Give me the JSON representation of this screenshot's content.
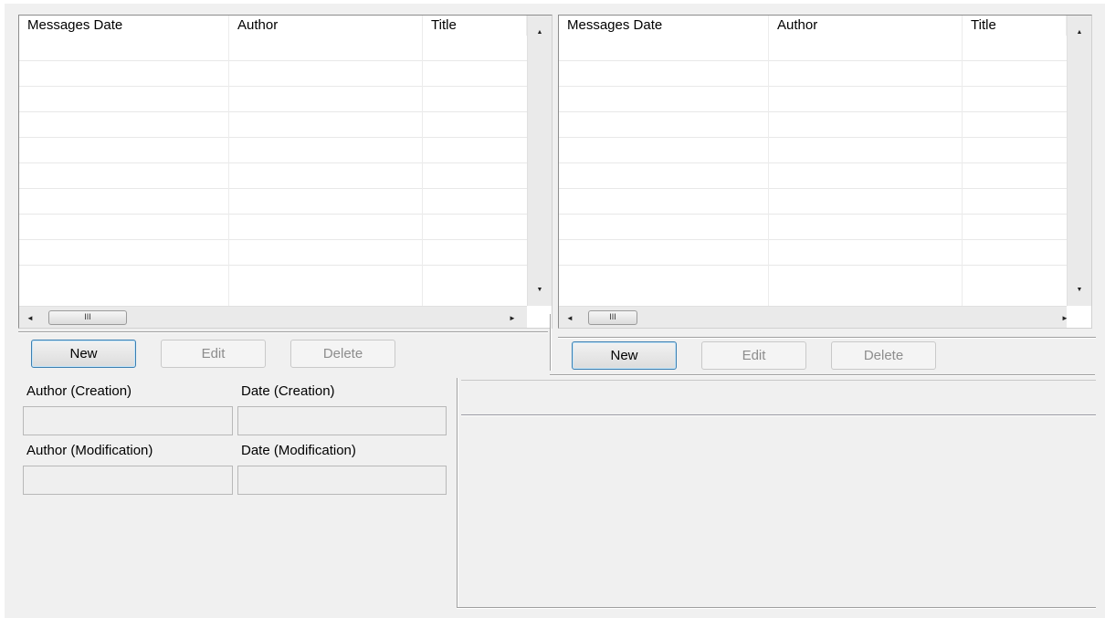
{
  "left_grid": {
    "columns": [
      "Messages Date",
      "Author",
      "Title"
    ],
    "row_count": 10
  },
  "right_grid": {
    "columns": [
      "Messages Date",
      "Author",
      "Title"
    ],
    "row_count": 10
  },
  "left_actions": {
    "new_label": "New",
    "edit_label": "Edit",
    "delete_label": "Delete"
  },
  "right_actions": {
    "new_label": "New",
    "edit_label": "Edit",
    "delete_label": "Delete"
  },
  "details": {
    "author_creation_label": "Author (Creation)",
    "date_creation_label": "Date (Creation)",
    "author_modification_label": "Author (Modification)",
    "date_modification_label": "Date (Modification)",
    "author_creation_value": "",
    "date_creation_value": "",
    "author_modification_value": "",
    "date_modification_value": ""
  },
  "scroll": {
    "up_arrow": "▲",
    "down_arrow": "▼",
    "left_arrow": "◄",
    "right_arrow": "►",
    "grip": "III"
  }
}
